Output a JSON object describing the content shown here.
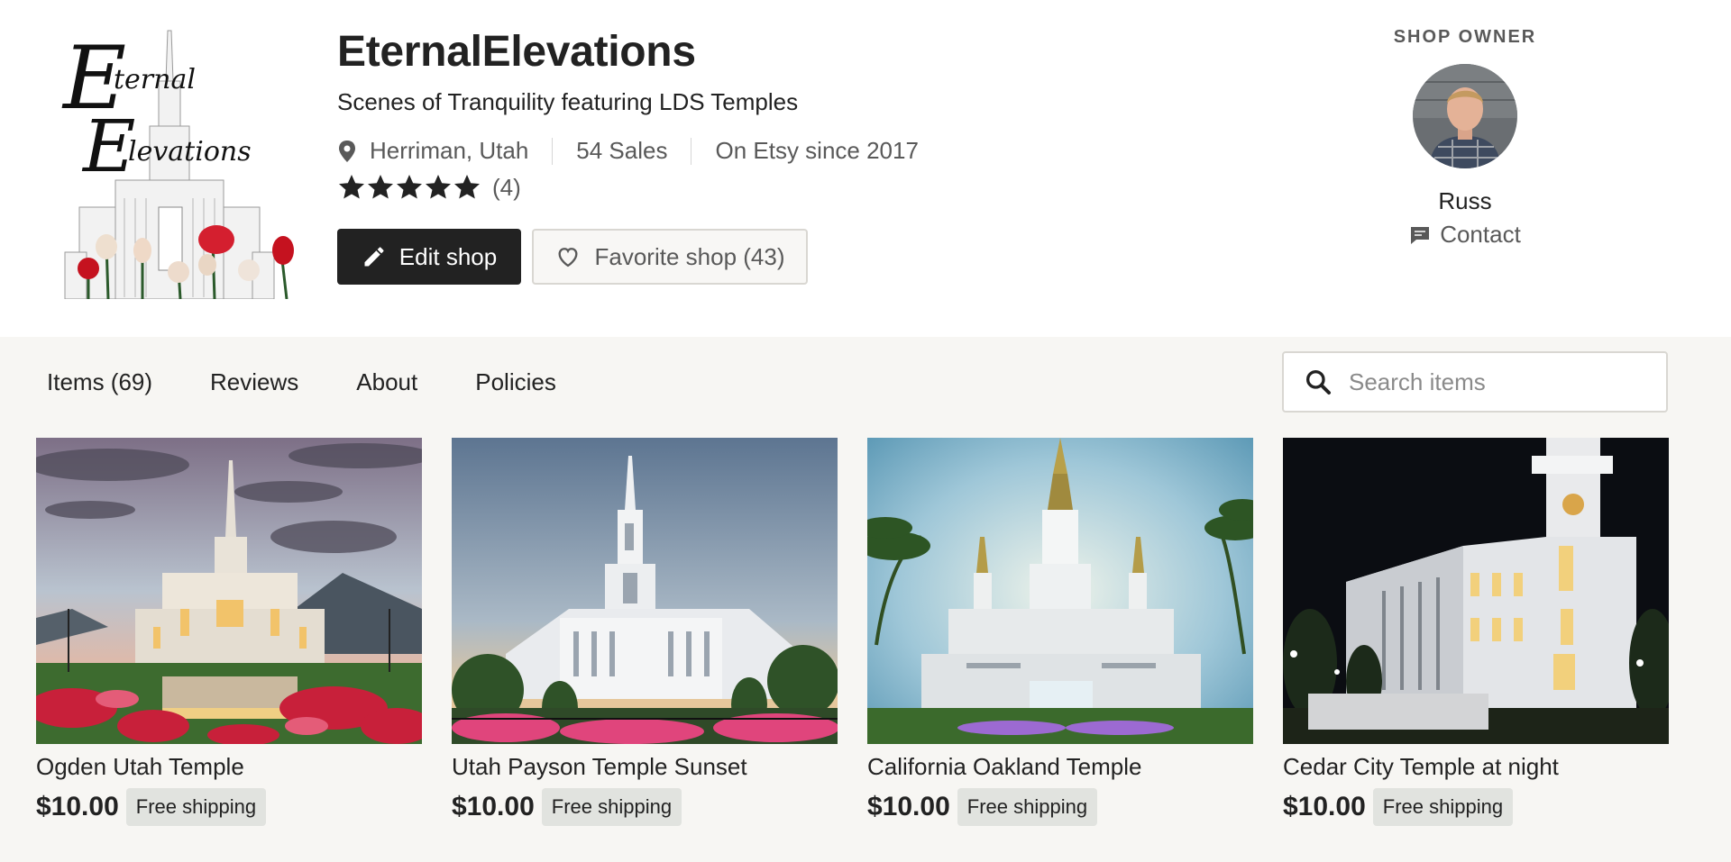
{
  "shop": {
    "name": "EternalElevations",
    "tagline": "Scenes of Tranquility featuring LDS Temples",
    "location": "Herriman, Utah",
    "sales": "54 Sales",
    "since": "On Etsy since 2017",
    "rating_stars": 5,
    "rating_count": "(4)",
    "edit_label": "Edit shop",
    "favorite_label": "Favorite shop (43)",
    "logo_text_line1": "Eternal",
    "logo_text_line2": "Elevations"
  },
  "owner": {
    "label": "SHOP OWNER",
    "name": "Russ",
    "contact_label": "Contact"
  },
  "tabs": [
    {
      "label": "Items (69)"
    },
    {
      "label": "Reviews"
    },
    {
      "label": "About"
    },
    {
      "label": "Policies"
    }
  ],
  "search": {
    "placeholder": "Search items"
  },
  "listings": [
    {
      "title": "Ogden Utah Temple",
      "price": "$10.00",
      "badge": "Free shipping"
    },
    {
      "title": "Utah Payson Temple Sunset",
      "price": "$10.00",
      "badge": "Free shipping"
    },
    {
      "title": "California Oakland Temple",
      "price": "$10.00",
      "badge": "Free shipping"
    },
    {
      "title": "Cedar City Temple at night",
      "price": "$10.00",
      "badge": "Free shipping"
    }
  ],
  "colors": {
    "primary_button": "#222222",
    "body_background": "#f7f6f3",
    "badge_background": "#e1e3df"
  }
}
